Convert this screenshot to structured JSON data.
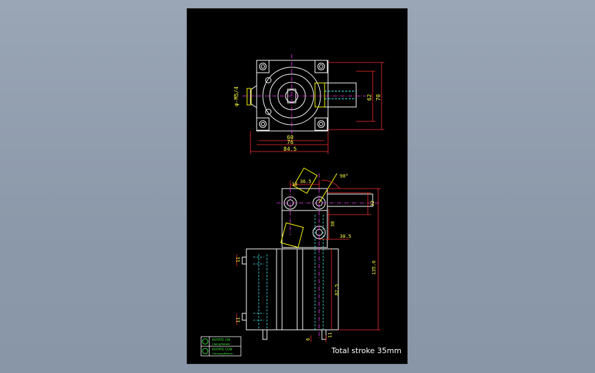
{
  "drawing": {
    "footer_note": "Total stroke 35mm",
    "colors": {
      "background": "#000000",
      "outline": "#ffffff",
      "dimension": "#ff3030",
      "dimension_text": "#ffff40",
      "centerline": "#ff40ff",
      "hidden": "#40ffff",
      "highlight": "#ffff00",
      "legend": "#40ff40"
    },
    "top_view": {
      "dims": {
        "d60": "60",
        "d76": "76",
        "d84_5": "84.5",
        "d62": "62",
        "d70": "70",
        "left": "φ-M5/4"
      }
    },
    "front_view": {
      "dims": {
        "d36_5": "36.5",
        "d10": "10",
        "d32": "32",
        "d38": "38",
        "d30_5": "30.5",
        "d135_6": "135.6",
        "d82_5": "82.5",
        "d11_top": "11",
        "d11_bottom": "11",
        "d6": "6",
        "d11_right": "11",
        "angle": "90°"
      }
    },
    "legend": {
      "rows": [
        {
          "label": "ROTATE CW",
          "sub": "Clamp/Rotate"
        },
        {
          "label": "ROTATE CCW",
          "sub": "Unclamp/Return"
        }
      ]
    }
  }
}
